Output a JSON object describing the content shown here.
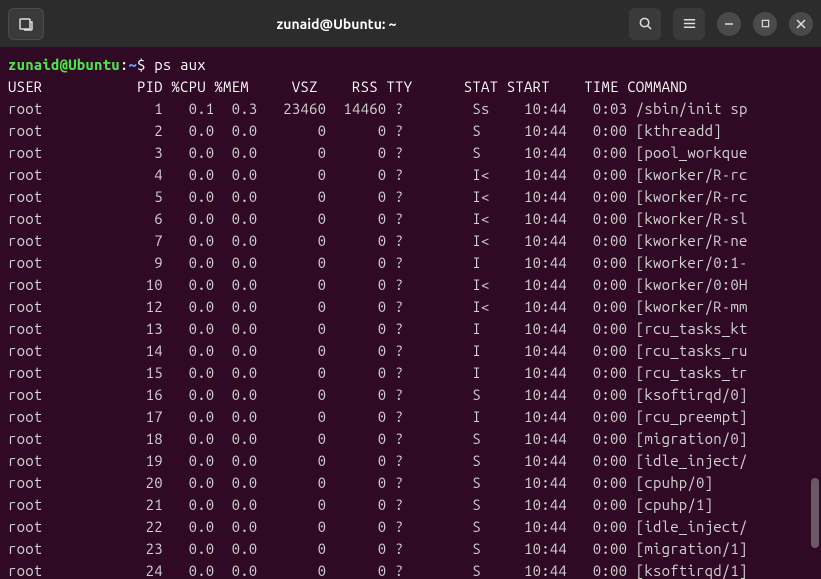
{
  "titlebar": {
    "title": "zunaid@Ubuntu: ~"
  },
  "prompt": {
    "user_host": "zunaid@Ubuntu",
    "path": "~",
    "command": "ps aux"
  },
  "header": {
    "user": "USER",
    "pid": "PID",
    "cpu": "%CPU",
    "mem": "%MEM",
    "vsz": "VSZ",
    "rss": "RSS",
    "tty": "TTY",
    "stat": "STAT",
    "start": "START",
    "time": "TIME",
    "command": "COMMAND"
  },
  "processes": [
    {
      "user": "root",
      "pid": "1",
      "cpu": "0.1",
      "mem": "0.3",
      "vsz": "23460",
      "rss": "14460",
      "tty": "?",
      "stat": "Ss",
      "start": "10:44",
      "time": "0:03",
      "cmd": "/sbin/init sp"
    },
    {
      "user": "root",
      "pid": "2",
      "cpu": "0.0",
      "mem": "0.0",
      "vsz": "0",
      "rss": "0",
      "tty": "?",
      "stat": "S",
      "start": "10:44",
      "time": "0:00",
      "cmd": "[kthreadd]"
    },
    {
      "user": "root",
      "pid": "3",
      "cpu": "0.0",
      "mem": "0.0",
      "vsz": "0",
      "rss": "0",
      "tty": "?",
      "stat": "S",
      "start": "10:44",
      "time": "0:00",
      "cmd": "[pool_workque"
    },
    {
      "user": "root",
      "pid": "4",
      "cpu": "0.0",
      "mem": "0.0",
      "vsz": "0",
      "rss": "0",
      "tty": "?",
      "stat": "I<",
      "start": "10:44",
      "time": "0:00",
      "cmd": "[kworker/R-rc"
    },
    {
      "user": "root",
      "pid": "5",
      "cpu": "0.0",
      "mem": "0.0",
      "vsz": "0",
      "rss": "0",
      "tty": "?",
      "stat": "I<",
      "start": "10:44",
      "time": "0:00",
      "cmd": "[kworker/R-rc"
    },
    {
      "user": "root",
      "pid": "6",
      "cpu": "0.0",
      "mem": "0.0",
      "vsz": "0",
      "rss": "0",
      "tty": "?",
      "stat": "I<",
      "start": "10:44",
      "time": "0:00",
      "cmd": "[kworker/R-sl"
    },
    {
      "user": "root",
      "pid": "7",
      "cpu": "0.0",
      "mem": "0.0",
      "vsz": "0",
      "rss": "0",
      "tty": "?",
      "stat": "I<",
      "start": "10:44",
      "time": "0:00",
      "cmd": "[kworker/R-ne"
    },
    {
      "user": "root",
      "pid": "9",
      "cpu": "0.0",
      "mem": "0.0",
      "vsz": "0",
      "rss": "0",
      "tty": "?",
      "stat": "I",
      "start": "10:44",
      "time": "0:00",
      "cmd": "[kworker/0:1-"
    },
    {
      "user": "root",
      "pid": "10",
      "cpu": "0.0",
      "mem": "0.0",
      "vsz": "0",
      "rss": "0",
      "tty": "?",
      "stat": "I<",
      "start": "10:44",
      "time": "0:00",
      "cmd": "[kworker/0:0H"
    },
    {
      "user": "root",
      "pid": "12",
      "cpu": "0.0",
      "mem": "0.0",
      "vsz": "0",
      "rss": "0",
      "tty": "?",
      "stat": "I<",
      "start": "10:44",
      "time": "0:00",
      "cmd": "[kworker/R-mm"
    },
    {
      "user": "root",
      "pid": "13",
      "cpu": "0.0",
      "mem": "0.0",
      "vsz": "0",
      "rss": "0",
      "tty": "?",
      "stat": "I",
      "start": "10:44",
      "time": "0:00",
      "cmd": "[rcu_tasks_kt"
    },
    {
      "user": "root",
      "pid": "14",
      "cpu": "0.0",
      "mem": "0.0",
      "vsz": "0",
      "rss": "0",
      "tty": "?",
      "stat": "I",
      "start": "10:44",
      "time": "0:00",
      "cmd": "[rcu_tasks_ru"
    },
    {
      "user": "root",
      "pid": "15",
      "cpu": "0.0",
      "mem": "0.0",
      "vsz": "0",
      "rss": "0",
      "tty": "?",
      "stat": "I",
      "start": "10:44",
      "time": "0:00",
      "cmd": "[rcu_tasks_tr"
    },
    {
      "user": "root",
      "pid": "16",
      "cpu": "0.0",
      "mem": "0.0",
      "vsz": "0",
      "rss": "0",
      "tty": "?",
      "stat": "S",
      "start": "10:44",
      "time": "0:00",
      "cmd": "[ksoftirqd/0]"
    },
    {
      "user": "root",
      "pid": "17",
      "cpu": "0.0",
      "mem": "0.0",
      "vsz": "0",
      "rss": "0",
      "tty": "?",
      "stat": "I",
      "start": "10:44",
      "time": "0:00",
      "cmd": "[rcu_preempt]"
    },
    {
      "user": "root",
      "pid": "18",
      "cpu": "0.0",
      "mem": "0.0",
      "vsz": "0",
      "rss": "0",
      "tty": "?",
      "stat": "S",
      "start": "10:44",
      "time": "0:00",
      "cmd": "[migration/0]"
    },
    {
      "user": "root",
      "pid": "19",
      "cpu": "0.0",
      "mem": "0.0",
      "vsz": "0",
      "rss": "0",
      "tty": "?",
      "stat": "S",
      "start": "10:44",
      "time": "0:00",
      "cmd": "[idle_inject/"
    },
    {
      "user": "root",
      "pid": "20",
      "cpu": "0.0",
      "mem": "0.0",
      "vsz": "0",
      "rss": "0",
      "tty": "?",
      "stat": "S",
      "start": "10:44",
      "time": "0:00",
      "cmd": "[cpuhp/0]"
    },
    {
      "user": "root",
      "pid": "21",
      "cpu": "0.0",
      "mem": "0.0",
      "vsz": "0",
      "rss": "0",
      "tty": "?",
      "stat": "S",
      "start": "10:44",
      "time": "0:00",
      "cmd": "[cpuhp/1]"
    },
    {
      "user": "root",
      "pid": "22",
      "cpu": "0.0",
      "mem": "0.0",
      "vsz": "0",
      "rss": "0",
      "tty": "?",
      "stat": "S",
      "start": "10:44",
      "time": "0:00",
      "cmd": "[idle_inject/"
    },
    {
      "user": "root",
      "pid": "23",
      "cpu": "0.0",
      "mem": "0.0",
      "vsz": "0",
      "rss": "0",
      "tty": "?",
      "stat": "S",
      "start": "10:44",
      "time": "0:00",
      "cmd": "[migration/1]"
    },
    {
      "user": "root",
      "pid": "24",
      "cpu": "0.0",
      "mem": "0.0",
      "vsz": "0",
      "rss": "0",
      "tty": "?",
      "stat": "S",
      "start": "10:44",
      "time": "0:00",
      "cmd": "[ksoftirqd/1]"
    }
  ]
}
